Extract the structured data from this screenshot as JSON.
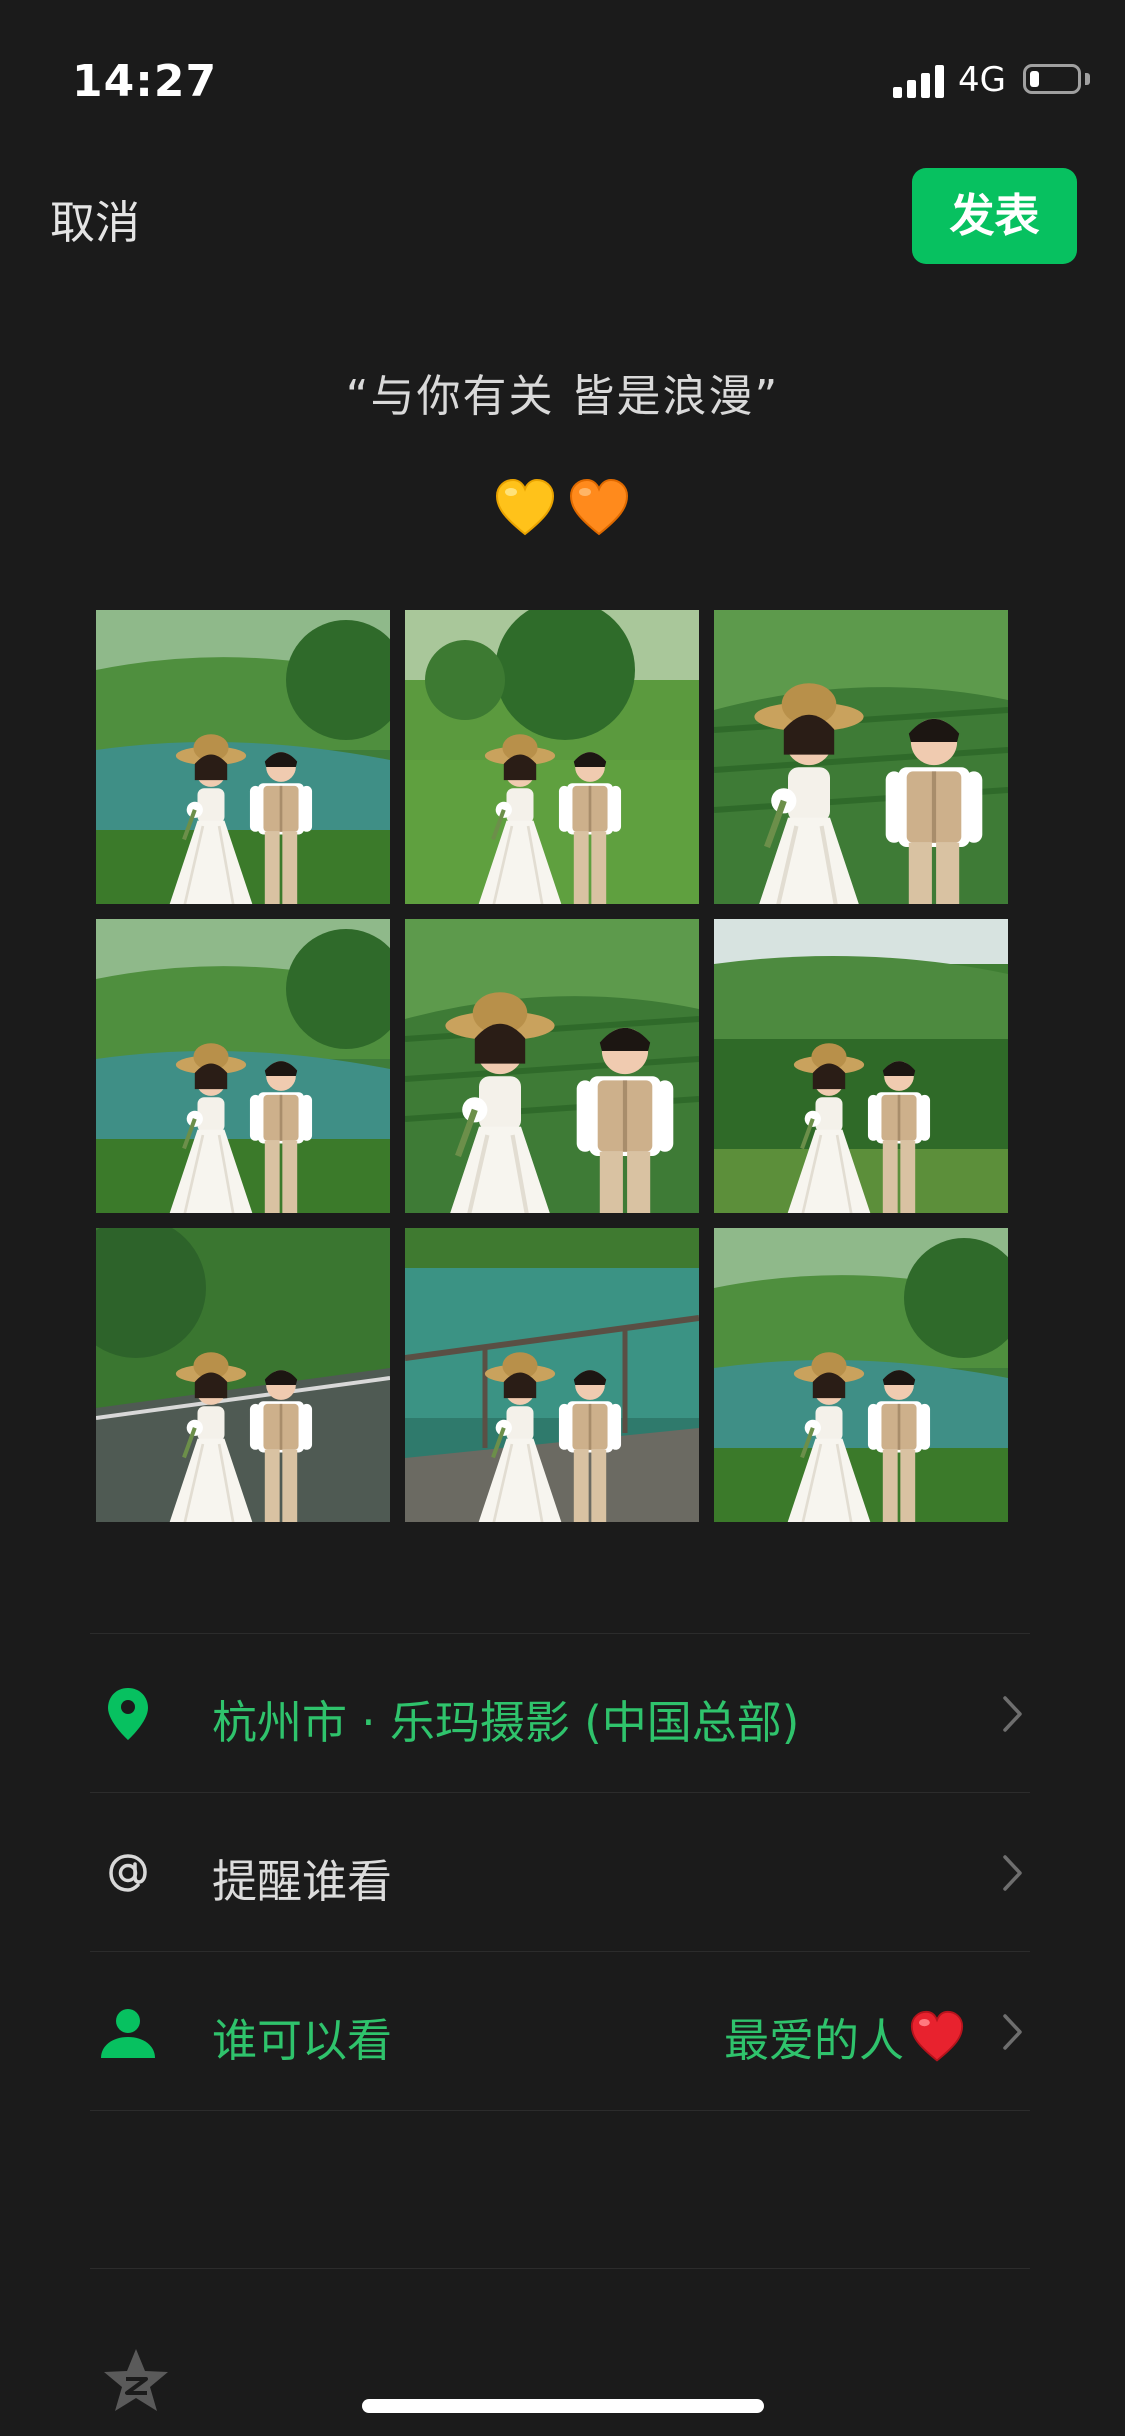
{
  "status_bar": {
    "time": "14:27",
    "network": "4G",
    "battery_level": 0.2
  },
  "nav": {
    "cancel_label": "取消",
    "publish_label": "发表"
  },
  "post": {
    "caption": "“与你有关 皆是浪漫”",
    "emoji": [
      "yellow-heart",
      "orange-heart"
    ],
    "photos": [
      {
        "name": "wedding-photo-1"
      },
      {
        "name": "wedding-photo-2"
      },
      {
        "name": "wedding-photo-3"
      },
      {
        "name": "wedding-photo-4"
      },
      {
        "name": "wedding-photo-5"
      },
      {
        "name": "wedding-photo-6"
      },
      {
        "name": "wedding-photo-7"
      },
      {
        "name": "wedding-photo-8"
      },
      {
        "name": "wedding-photo-9"
      }
    ]
  },
  "options": {
    "location": {
      "label": "杭州市 · 乐玛摄影 (中国总部)",
      "icon": "location-pin-icon"
    },
    "mention": {
      "label": "提醒谁看",
      "icon": "at-sign-icon"
    },
    "visibility": {
      "label": "谁可以看",
      "value": "最爱的人",
      "icon": "person-icon",
      "value_icon": "red-heart-icon"
    }
  },
  "colors": {
    "accent": "#07c160",
    "accent_text": "#2fc36c",
    "background": "#1b1b1b"
  }
}
